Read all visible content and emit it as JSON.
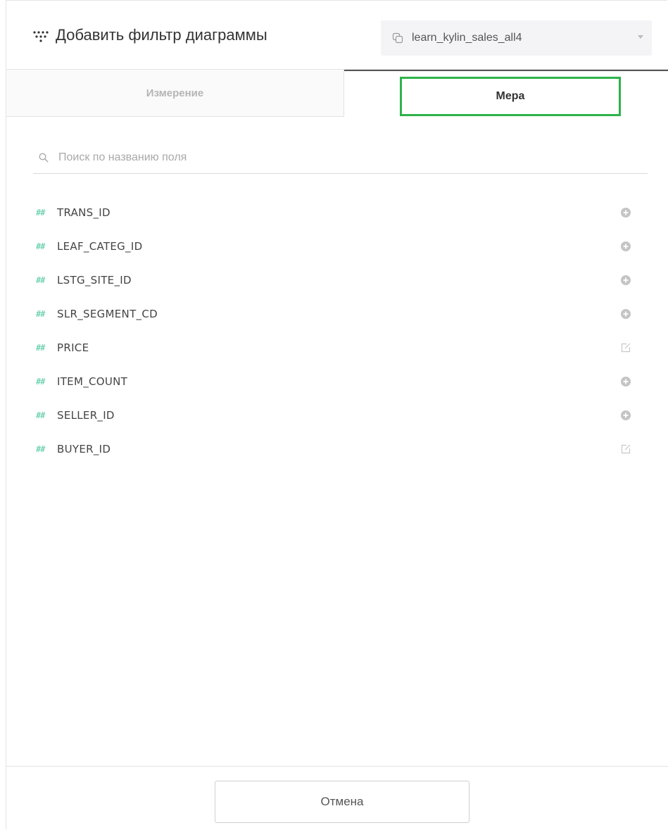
{
  "header": {
    "title": "Добавить фильтр диаграммы",
    "title_icon": "scatter-dots-icon",
    "dataset": {
      "icon": "dataset-icon",
      "value": "learn_kylin_sales_all4"
    }
  },
  "tabs": [
    {
      "label": "Измерение",
      "active": false
    },
    {
      "label": "Мера",
      "active": true
    }
  ],
  "search": {
    "icon": "search-icon",
    "placeholder": "Поиск по названию поля",
    "value": ""
  },
  "fields": [
    {
      "type_marker": "##",
      "name": "TRANS_ID",
      "action": "add-icon"
    },
    {
      "type_marker": "##",
      "name": "LEAF_CATEG_ID",
      "action": "add-icon"
    },
    {
      "type_marker": "##",
      "name": "LSTG_SITE_ID",
      "action": "add-icon"
    },
    {
      "type_marker": "##",
      "name": "SLR_SEGMENT_CD",
      "action": "add-icon"
    },
    {
      "type_marker": "##",
      "name": "PRICE",
      "action": "edit-icon"
    },
    {
      "type_marker": "##",
      "name": "ITEM_COUNT",
      "action": "add-icon"
    },
    {
      "type_marker": "##",
      "name": "SELLER_ID",
      "action": "add-icon"
    },
    {
      "type_marker": "##",
      "name": "BUYER_ID",
      "action": "edit-icon"
    }
  ],
  "footer": {
    "cancel_label": "Отмена"
  },
  "colors": {
    "accent_green": "#2db34a",
    "type_marker": "#4fc8a1",
    "active_tab_border": "#555555"
  }
}
